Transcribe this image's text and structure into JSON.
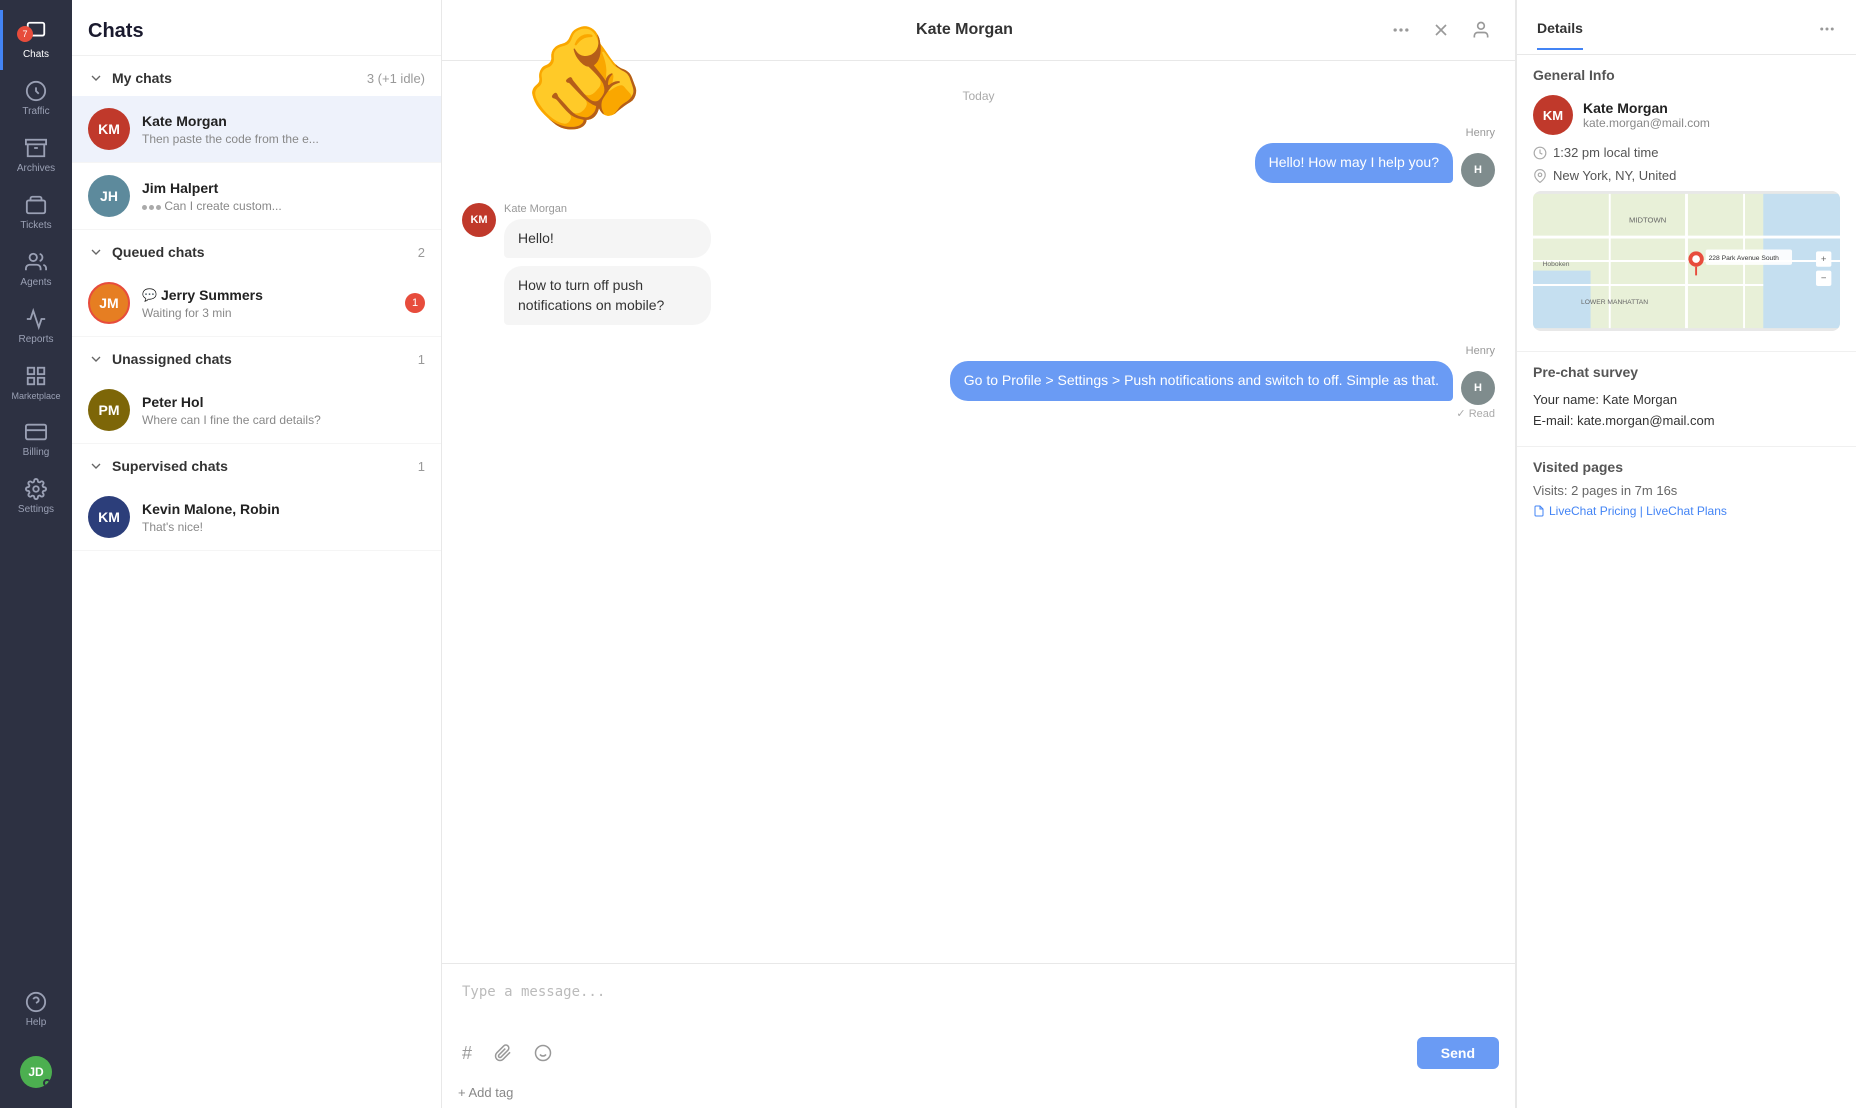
{
  "nav": {
    "items": [
      {
        "id": "chats",
        "label": "Chats",
        "active": true,
        "badge": "7"
      },
      {
        "id": "traffic",
        "label": "Traffic",
        "active": false
      },
      {
        "id": "archives",
        "label": "Archives",
        "active": false
      },
      {
        "id": "tickets",
        "label": "Tickets",
        "active": false
      },
      {
        "id": "agents",
        "label": "Agents",
        "active": false
      },
      {
        "id": "reports",
        "label": "Reports",
        "active": false
      },
      {
        "id": "marketplace",
        "label": "Marketplace",
        "active": false
      },
      {
        "id": "billing",
        "label": "Billing",
        "active": false
      },
      {
        "id": "settings",
        "label": "Settings",
        "active": false
      },
      {
        "id": "help",
        "label": "Help",
        "active": false
      }
    ],
    "user_initials": "JD"
  },
  "chat_list": {
    "title": "Chats",
    "sections": [
      {
        "id": "my-chats",
        "title": "My chats",
        "count": "3 (+1 idle)",
        "expanded": true,
        "items": [
          {
            "id": "kate-morgan",
            "name": "Kate Morgan",
            "preview": "Then paste the code from the e...",
            "avatar_initials": "KM",
            "avatar_color": "#c0392b",
            "active": true
          },
          {
            "id": "jim-halpert",
            "name": "Jim Halpert",
            "preview": "Can I create custom...",
            "avatar_initials": "JH",
            "avatar_color": "#5d8a9c",
            "typing": true
          }
        ]
      },
      {
        "id": "queued-chats",
        "title": "Queued chats",
        "count": "2",
        "expanded": true,
        "items": [
          {
            "id": "jerry-summers",
            "name": "Jerry Summers",
            "preview": "Waiting for 3 min",
            "avatar_initials": "JM",
            "avatar_color": "#e67e22",
            "badge": "1",
            "has_messenger": true
          }
        ]
      },
      {
        "id": "unassigned-chats",
        "title": "Unassigned chats",
        "count": "1",
        "expanded": true,
        "items": [
          {
            "id": "peter-hol",
            "name": "Peter Hol",
            "preview": "Where can I fine the card details?",
            "avatar_initials": "PM",
            "avatar_color": "#7d6608"
          }
        ]
      },
      {
        "id": "supervised-chats",
        "title": "Supervised chats",
        "count": "1",
        "expanded": true,
        "items": [
          {
            "id": "kevin-malone",
            "name": "Kevin Malone, Robin",
            "preview": "That's nice!",
            "avatar_initials": "KM",
            "avatar_color": "#2c3e7a"
          }
        ]
      }
    ]
  },
  "chat_main": {
    "contact_name": "Kate Morgan",
    "date_divider": "Today",
    "messages": [
      {
        "sender": "agent",
        "sender_name": "Henry",
        "text": "Hello! How may I help you?",
        "avatar_color": "#7f8c8d",
        "avatar_initials": "H"
      },
      {
        "sender": "customer",
        "sender_name": "Kate Morgan",
        "text": "Hello!",
        "avatar_color": "#c0392b",
        "avatar_initials": "KM"
      },
      {
        "sender": "customer",
        "sender_name": "",
        "text": "How to turn off push notifications on mobile?",
        "avatar_color": "#c0392b",
        "avatar_initials": "KM"
      },
      {
        "sender": "agent",
        "sender_name": "Henry",
        "text": "Go to Profile > Settings > Push notifications and switch to off. Simple as that.",
        "avatar_color": "#7f8c8d",
        "avatar_initials": "H",
        "read": true
      }
    ],
    "read_label": "✓ Read",
    "input_placeholder": "Type a message...",
    "send_label": "Send",
    "add_tag_label": "+ Add tag"
  },
  "details": {
    "title": "Details",
    "tabs": [
      {
        "id": "details",
        "label": "Details",
        "active": true
      },
      {
        "id": "visitor",
        "label": "",
        "active": false
      }
    ],
    "general_info": {
      "section_title": "General Info",
      "name": "Kate Morgan",
      "email": "kate.morgan@mail.com",
      "avatar_initials": "KM",
      "avatar_color": "#c0392b",
      "local_time": "1:32 pm local time",
      "location": "New York, NY, United"
    },
    "prechat_survey": {
      "section_title": "Pre-chat survey",
      "name_label": "Your name:",
      "name_value": "Kate Morgan",
      "email_label": "E-mail:",
      "email_value": "kate.morgan@mail.com"
    },
    "visited_pages": {
      "section_title": "Visited pages",
      "visits_label": "Visits:",
      "visits_value": "2 pages in 7m 16s",
      "pages": [
        "LiveChat Pricing | LiveChat Plans"
      ]
    }
  }
}
